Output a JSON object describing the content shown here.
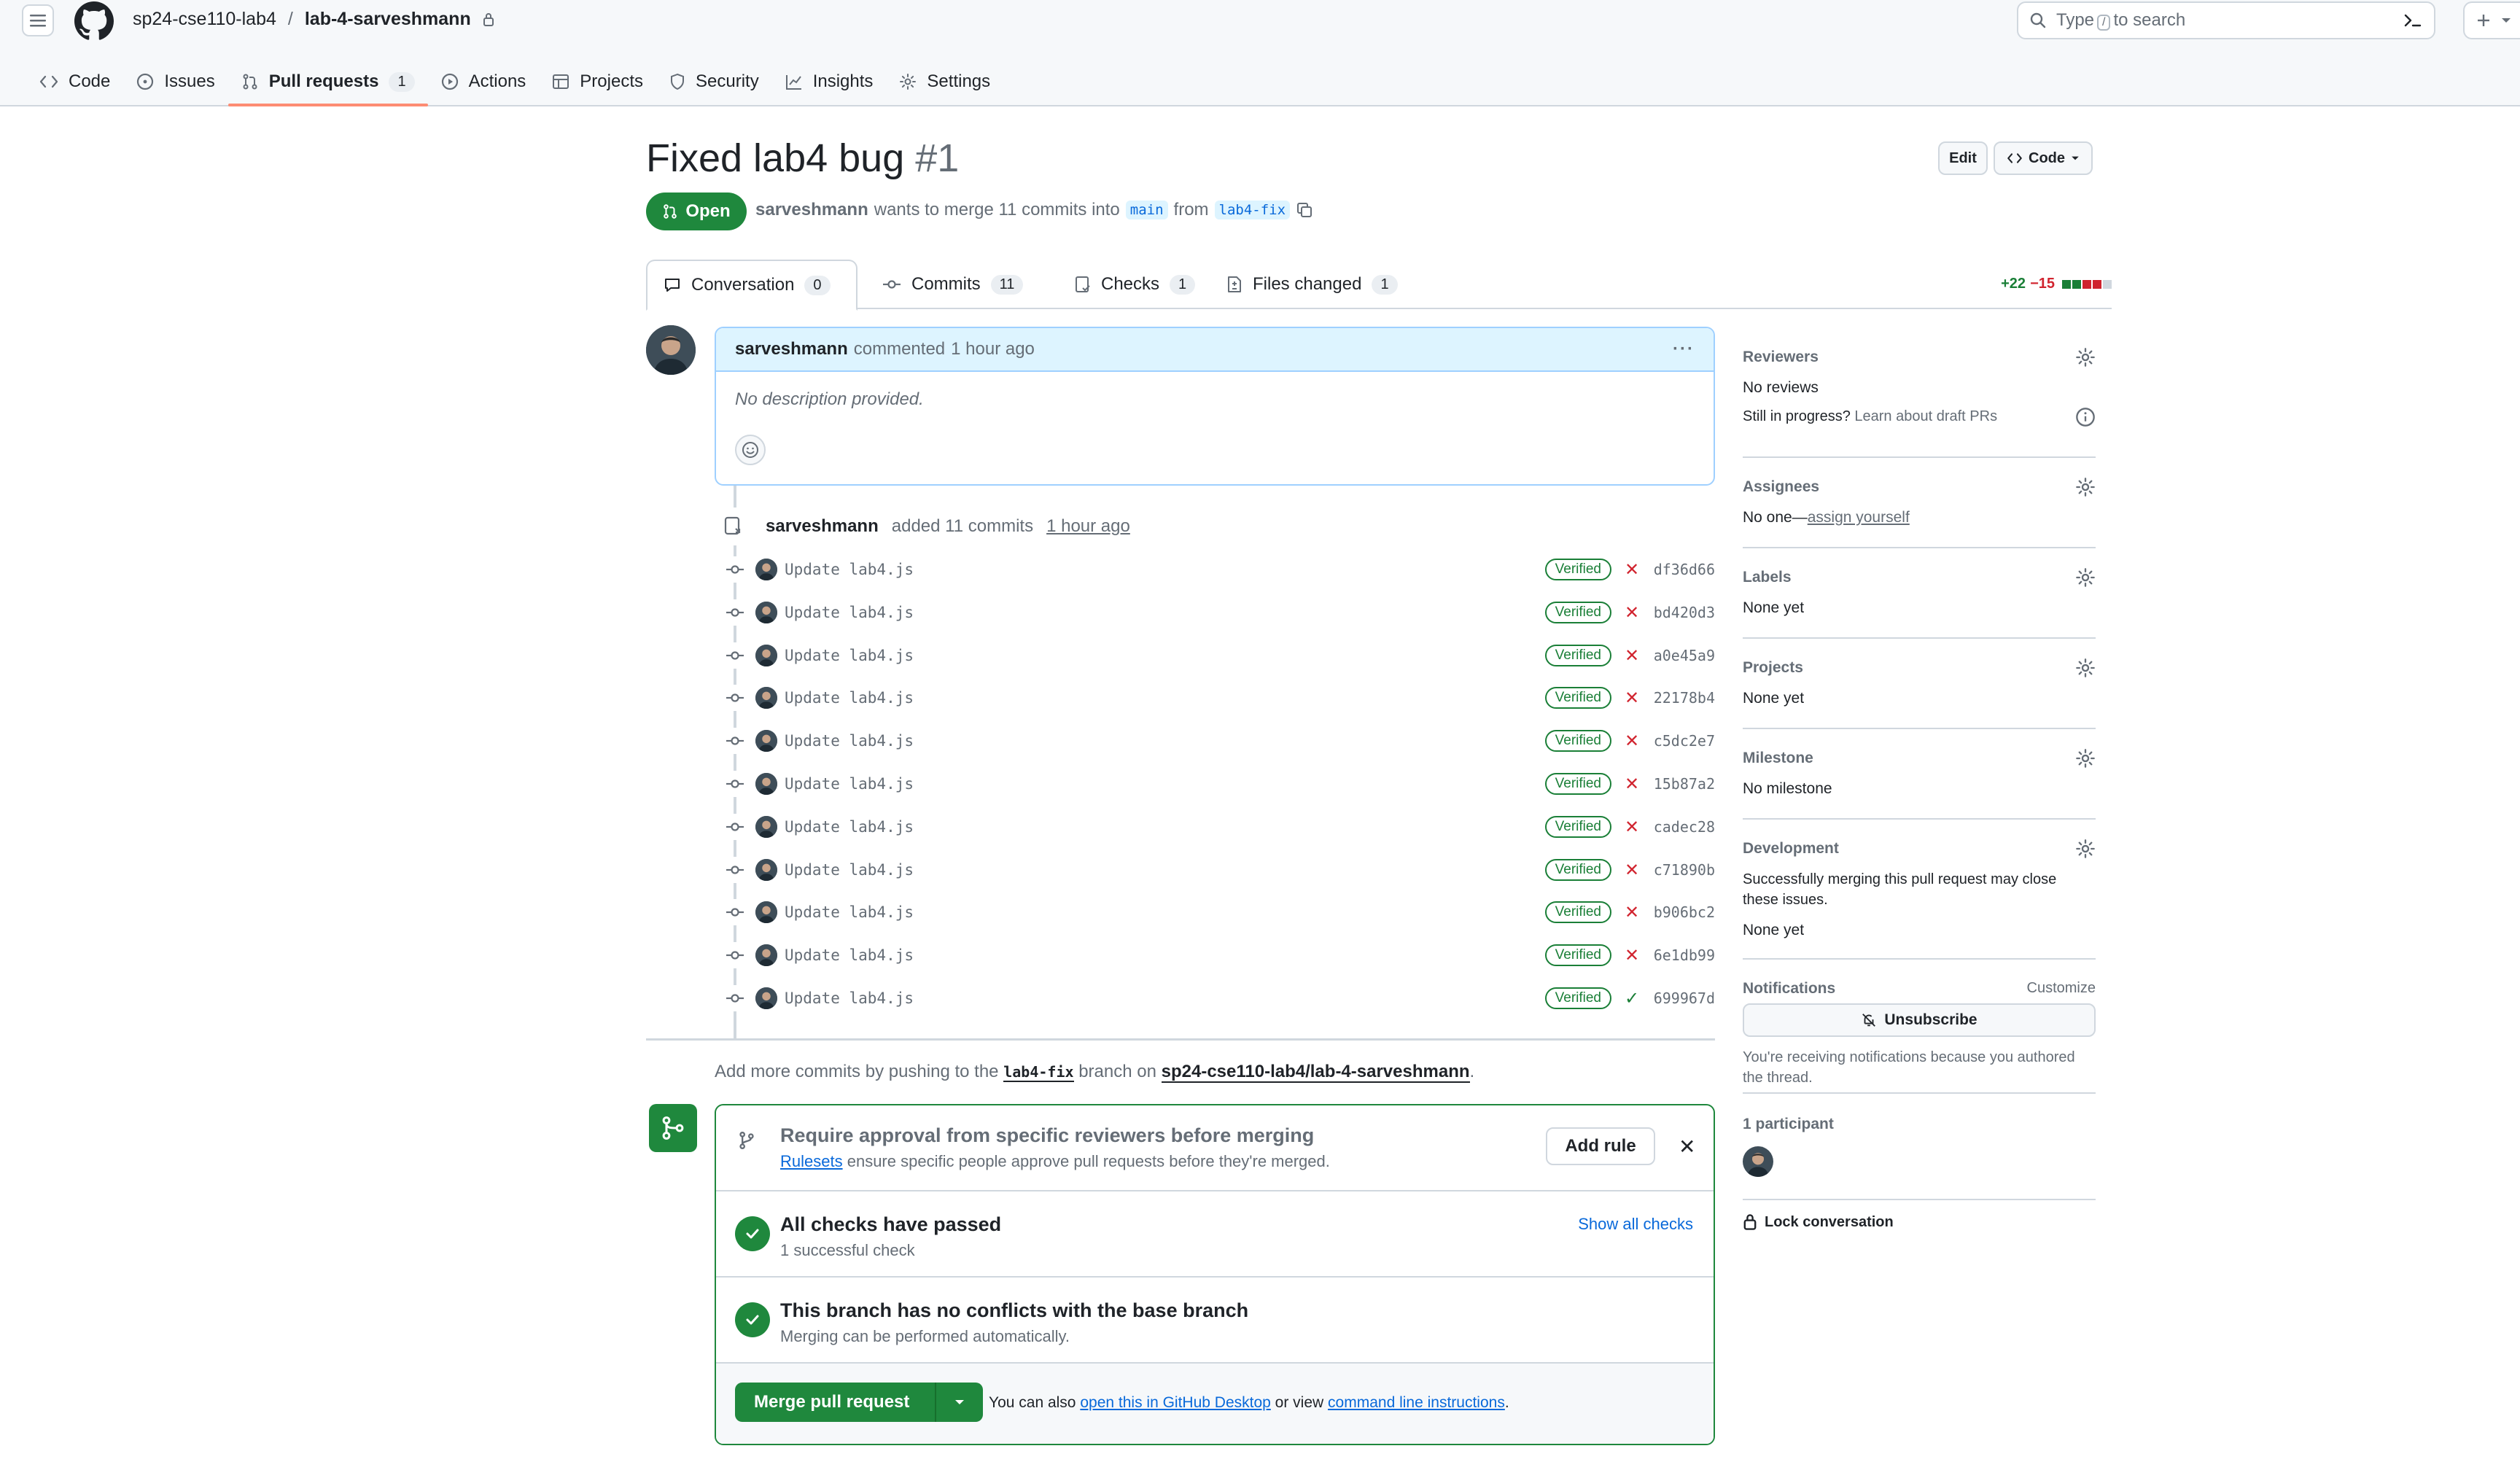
{
  "header": {
    "owner": "sp24-cse110-lab4",
    "separator": "/",
    "repo": "lab-4-sarveshmann",
    "search_prefix": "Type",
    "search_key": "/",
    "search_suffix": "to search"
  },
  "repo_nav": {
    "tabs": [
      {
        "label": "Code",
        "icon": "code-icon"
      },
      {
        "label": "Issues",
        "icon": "issue-icon"
      },
      {
        "label": "Pull requests",
        "icon": "pull-request-icon",
        "count": "1",
        "active": true
      },
      {
        "label": "Actions",
        "icon": "play-icon"
      },
      {
        "label": "Projects",
        "icon": "table-icon"
      },
      {
        "label": "Security",
        "icon": "shield-icon"
      },
      {
        "label": "Insights",
        "icon": "graph-icon"
      },
      {
        "label": "Settings",
        "icon": "gear-icon"
      }
    ]
  },
  "pr": {
    "title": "Fixed lab4 bug",
    "number": "#1",
    "edit_label": "Edit",
    "code_label": "Code",
    "state": "Open",
    "author": "sarveshmann",
    "merge_text": "wants to merge 11 commits into",
    "base_branch": "main",
    "from_text": "from",
    "head_branch": "lab4-fix"
  },
  "tabs": {
    "conversation": {
      "label": "Conversation",
      "count": "0"
    },
    "commits": {
      "label": "Commits",
      "count": "11"
    },
    "checks": {
      "label": "Checks",
      "count": "1"
    },
    "files": {
      "label": "Files changed",
      "count": "1"
    },
    "additions": "+22",
    "deletions": "−15"
  },
  "comment": {
    "author": "sarveshmann",
    "action": "commented",
    "time": "1 hour ago",
    "body": "No description provided.",
    "menu": "···"
  },
  "push_event": {
    "author": "sarveshmann",
    "action": "added 11 commits",
    "time": "1 hour ago"
  },
  "commits": [
    {
      "message": "Update lab4.js",
      "verified": "Verified",
      "status": "fail",
      "sha": "df36d66"
    },
    {
      "message": "Update lab4.js",
      "verified": "Verified",
      "status": "fail",
      "sha": "bd420d3"
    },
    {
      "message": "Update lab4.js",
      "verified": "Verified",
      "status": "fail",
      "sha": "a0e45a9"
    },
    {
      "message": "Update lab4.js",
      "verified": "Verified",
      "status": "fail",
      "sha": "22178b4"
    },
    {
      "message": "Update lab4.js",
      "verified": "Verified",
      "status": "fail",
      "sha": "c5dc2e7"
    },
    {
      "message": "Update lab4.js",
      "verified": "Verified",
      "status": "fail",
      "sha": "15b87a2"
    },
    {
      "message": "Update lab4.js",
      "verified": "Verified",
      "status": "fail",
      "sha": "cadec28"
    },
    {
      "message": "Update lab4.js",
      "verified": "Verified",
      "status": "fail",
      "sha": "c71890b"
    },
    {
      "message": "Update lab4.js",
      "verified": "Verified",
      "status": "fail",
      "sha": "b906bc2"
    },
    {
      "message": "Update lab4.js",
      "verified": "Verified",
      "status": "fail",
      "sha": "6e1db99"
    },
    {
      "message": "Update lab4.js",
      "verified": "Verified",
      "status": "pass",
      "sha": "699967d"
    }
  ],
  "add_more": {
    "prefix": "Add more commits by pushing to the",
    "branch": "lab4-fix",
    "middle": "branch on",
    "repo": "sp24-cse110-lab4/lab-4-sarveshmann",
    "suffix": "."
  },
  "merge_box": {
    "ruleset_title": "Require approval from specific reviewers before merging",
    "ruleset_link": "Rulesets",
    "ruleset_text": "ensure specific people approve pull requests before they're merged.",
    "add_rule": "Add rule",
    "checks_title": "All checks have passed",
    "checks_sub": "1 successful check",
    "show_checks": "Show all checks",
    "conflicts_title": "This branch has no conflicts with the base branch",
    "conflicts_sub": "Merging can be performed automatically.",
    "merge_button": "Merge pull request",
    "also_prefix": "You can also",
    "desktop_link": "open this in GitHub Desktop",
    "or_view": "or view",
    "cli_link": "command line instructions",
    "also_suffix": "."
  },
  "sidebar": {
    "reviewers_title": "Reviewers",
    "reviewers_value": "No reviews",
    "draft_q": "Still in progress?",
    "draft_link": "Learn about draft PRs",
    "assignees_title": "Assignees",
    "assignees_value": "No one—",
    "assign_link": "assign yourself",
    "labels_title": "Labels",
    "labels_value": "None yet",
    "projects_title": "Projects",
    "projects_value": "None yet",
    "milestone_title": "Milestone",
    "milestone_value": "No milestone",
    "development_title": "Development",
    "development_text": "Successfully merging this pull request may close these issues.",
    "development_value": "None yet",
    "notifications_title": "Notifications",
    "customize": "Customize",
    "unsubscribe": "Unsubscribe",
    "notif_reason": "You're receiving notifications because you authored the thread.",
    "participants": "1 participant",
    "lock": "Lock conversation"
  },
  "colors": {
    "accent_green": "#1f883d",
    "link_blue": "#0969da",
    "danger_red": "#d1242f",
    "active_tab_underline": "#fd8c73"
  }
}
